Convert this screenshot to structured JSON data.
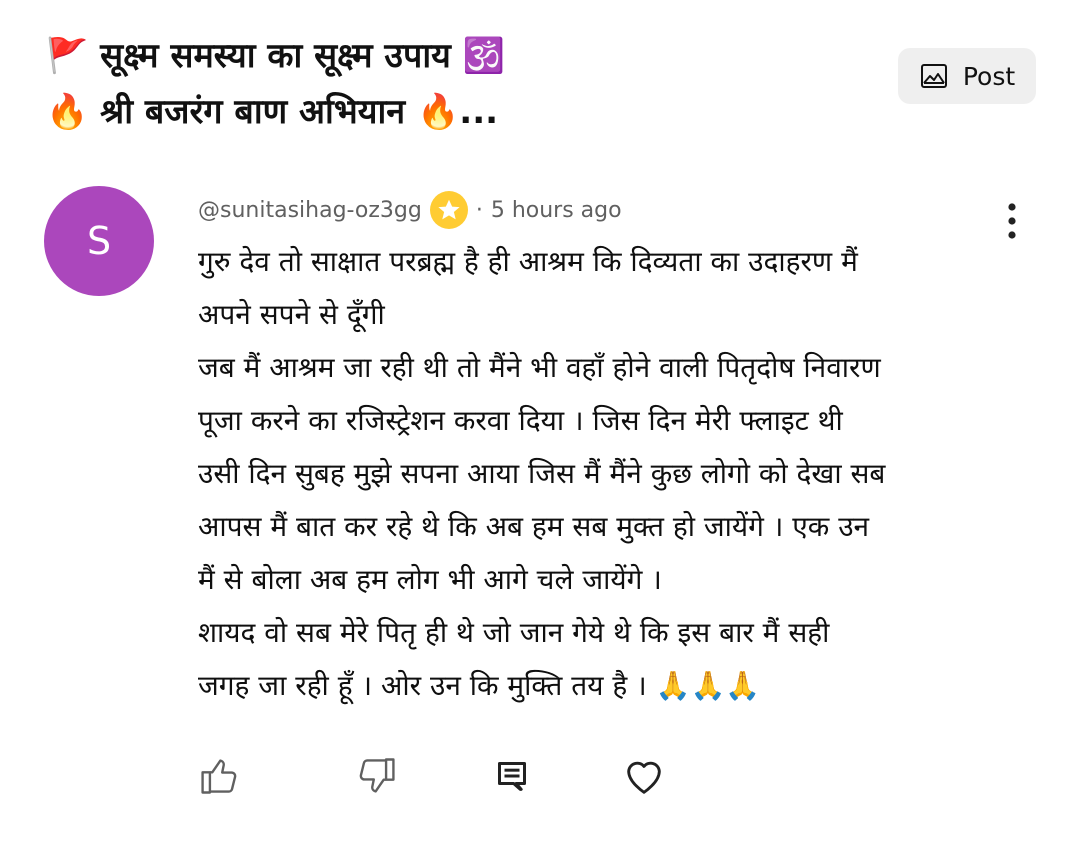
{
  "header": {
    "title_line1": "🚩 सूक्ष्म समस्या का सूक्ष्म उपाय 🕉️",
    "title_line2": "🔥 श्री बजरंग बाण अभियान 🔥...",
    "post_button_label": "Post"
  },
  "comment": {
    "avatar_letter": "S",
    "avatar_color": "#ab47bc",
    "author": "@sunitasihag-oz3gg",
    "separator": "·",
    "time_ago": "5 hours ago",
    "body_lines": [
      "गुरु देव तो साक्षात परब्रह्म है ही आश्रम कि दिव्यता का उदाहरण मैं",
      "अपने सपने से दूँगी",
      "जब मैं आश्रम जा रही थी तो मैंने भी वहाँ होने वाली पितृदोष निवारण",
      "पूजा करने का रजिस्ट्रेशन करवा दिया । जिस दिन मेरी फ्लाइट थी",
      "उसी दिन सुबह मुझे सपना आया जिस मैं मैंने कुछ लोगो को देखा सब",
      "आपस मैं बात कर रहे थे कि अब हम सब मुक्त हो जायेंगे । एक उन",
      "मैं से बोला अब हम लोग भी आगे चले जायेंगे ।",
      "शायद वो सब मेरे पितृ ही थे जो जान गेये थे कि इस बार मैं सही",
      "जगह जा रही हूँ । ओर उन कि मुक्ति तय है । 🙏🙏🙏"
    ]
  },
  "icons": {
    "post_image": "image-icon",
    "badge": "star-badge-icon",
    "more": "more-vertical-icon",
    "like": "thumbs-up-icon",
    "dislike": "thumbs-down-icon",
    "reply": "reply-comment-icon",
    "heart": "heart-icon"
  },
  "colors": {
    "badge": "#ffcc33",
    "button_bg": "#efefef",
    "meta_text": "#606060"
  }
}
